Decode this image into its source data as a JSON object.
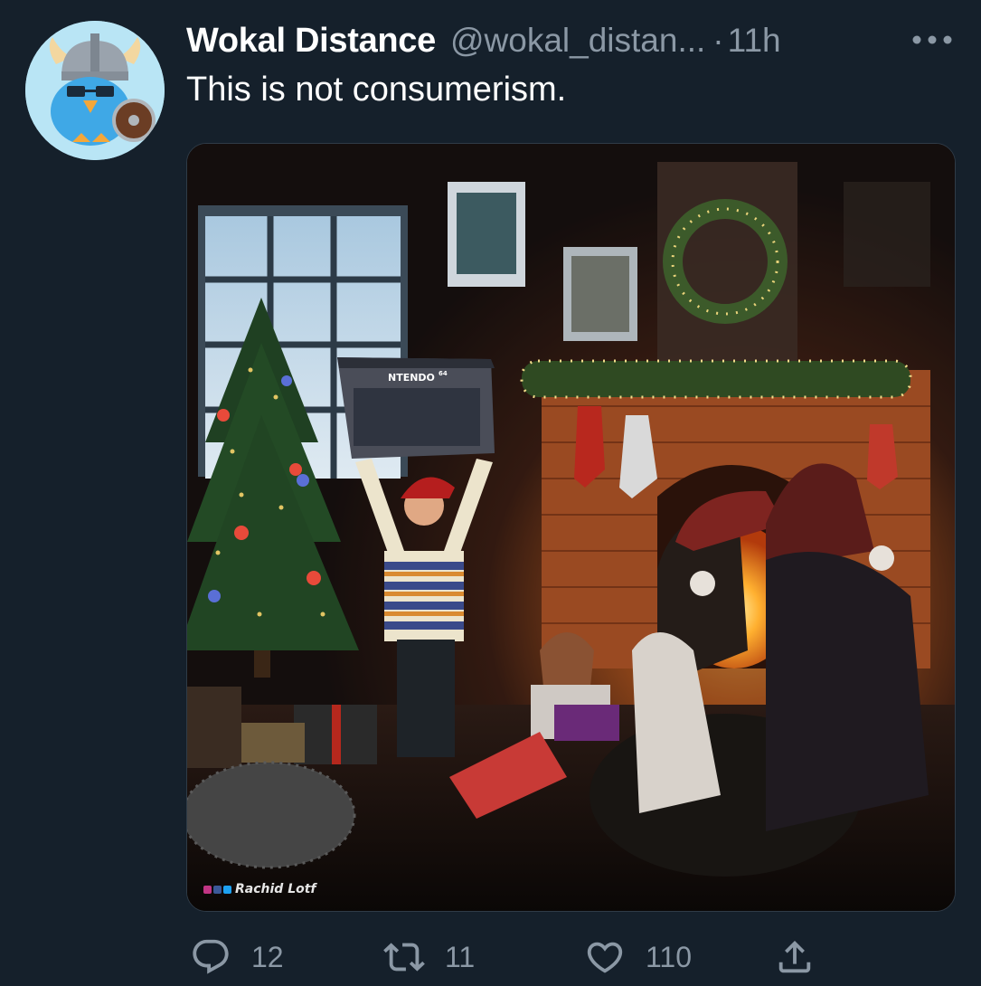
{
  "tweet": {
    "author": {
      "display_name": "Wokal Distance",
      "handle": "@wokal_distan...",
      "avatar_icon": "viking-bird-avatar"
    },
    "separator": "·",
    "timestamp": "11h",
    "more_icon": "more-horizontal-icon",
    "text": "This is not consumerism.",
    "media": {
      "watermark": "Rachid Lotf",
      "box_label": "NTENDO",
      "box_superscript": "64"
    },
    "actions": {
      "reply": {
        "icon": "reply-icon",
        "count": "12"
      },
      "retweet": {
        "icon": "retweet-icon",
        "count": "11"
      },
      "like": {
        "icon": "like-icon",
        "count": "110"
      },
      "share": {
        "icon": "share-icon"
      }
    }
  },
  "colors": {
    "background": "#15202b",
    "text_primary": "#ffffff",
    "text_secondary": "#8b98a5"
  }
}
